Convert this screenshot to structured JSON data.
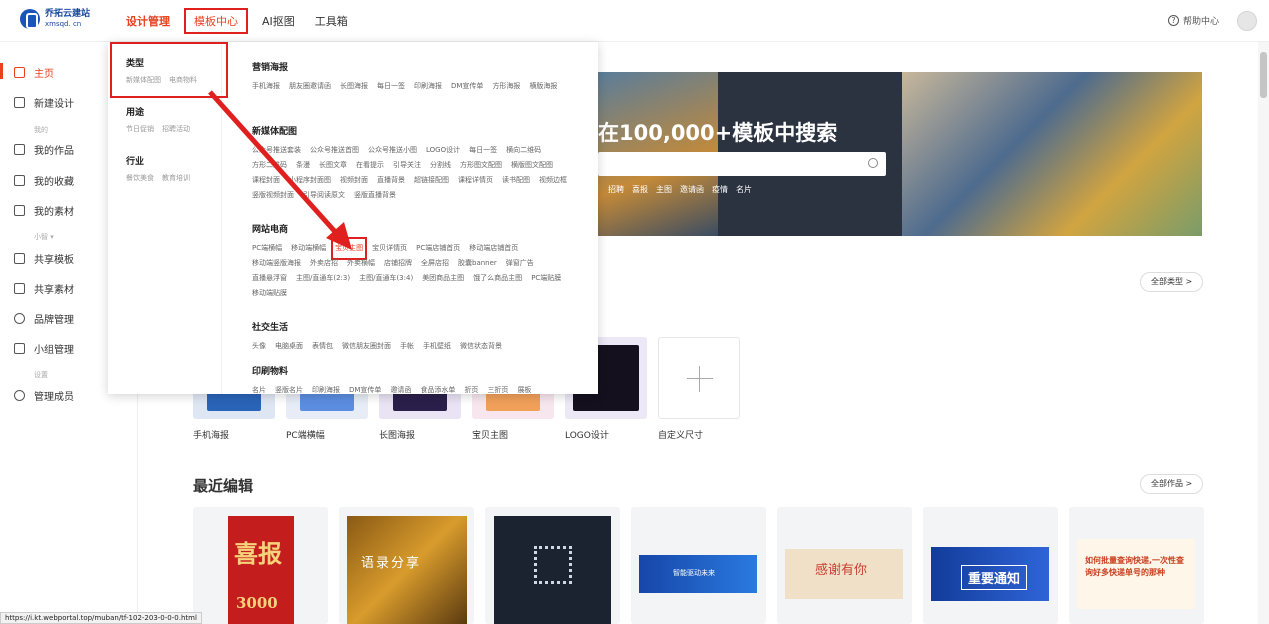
{
  "header": {
    "logo_cn": "乔拓云建站",
    "logo_en": "xmsqd. cn",
    "nav": [
      "设计管理",
      "模板中心",
      "AI抠图",
      "工具箱"
    ],
    "help": "帮助中心"
  },
  "sidebar": {
    "items": [
      {
        "label": "主页"
      },
      {
        "label": "新建设计"
      },
      {
        "label": "我的作品"
      },
      {
        "label": "我的收藏"
      },
      {
        "label": "我的素材"
      },
      {
        "label": "共享模板"
      },
      {
        "label": "共享素材"
      },
      {
        "label": "品牌管理"
      },
      {
        "label": "小组管理"
      },
      {
        "label": "管理成员"
      }
    ],
    "sections": [
      "我的",
      "小智 ▾",
      "设置"
    ]
  },
  "dropdown": {
    "left": [
      {
        "head": "类型",
        "subs": [
          "新媒体配图",
          "电商物料"
        ]
      },
      {
        "head": "用途",
        "subs": [
          "节日促销",
          "招聘活动"
        ]
      },
      {
        "head": "行业",
        "subs": [
          "餐饮美食",
          "教育培训"
        ]
      }
    ],
    "categories": [
      {
        "title": "营销海报",
        "items": [
          "手机海报",
          "朋友圈邀请函",
          "长图海报",
          "每日一签",
          "印刷海报",
          "DM宣传单",
          "方形海报",
          "横版海报"
        ]
      },
      {
        "title": "新媒体配图",
        "items": [
          "公众号推送套装",
          "公众号推送首图",
          "公众号推送小图",
          "LOGO设计",
          "每日一签",
          "横向二维码",
          "方形二维码",
          "条漫",
          "长图文章",
          "在看提示",
          "引导关注",
          "分割线",
          "方形图文配图",
          "横版图文配图",
          "课程封面",
          "小程序封面图",
          "视频封面",
          "直播背景",
          "超链接配图",
          "课程详情页",
          "读书配图",
          "视频边框",
          "竖版视频封面",
          "引导阅读原文",
          "竖版直播背景"
        ]
      },
      {
        "title": "网站电商",
        "items": [
          "PC端横幅",
          "移动端横幅",
          "宝贝主图",
          "宝贝详情页",
          "PC端店铺首页",
          "移动端店铺首页",
          "移动端竖版海报",
          "外卖店招",
          "外卖横幅",
          "店铺招牌",
          "全屏店招",
          "胶囊banner",
          "弹窗广告",
          "直播悬浮窗",
          "主图/直通车(2:3)",
          "主图/直通车(3:4)",
          "美团商品主图",
          "饿了么商品主图",
          "PC端贴膜",
          "移动端贴膜"
        ]
      },
      {
        "title": "社交生活",
        "items": [
          "头像",
          "电脑桌面",
          "表情包",
          "微信朋友圈封面",
          "手帐",
          "手机壁纸",
          "微信状态背景"
        ]
      },
      {
        "title": "印刷物料",
        "items": [
          "名片",
          "竖版名片",
          "印刷海报",
          "DM宣传单",
          "邀请函",
          "食品添水单",
          "折页",
          "三折页",
          "展板"
        ]
      }
    ]
  },
  "banner": {
    "title": "在100,000+模板中搜索",
    "search_placeholder": "",
    "hot_tags": [
      "招聘",
      "喜报",
      "主图",
      "邀请函",
      "疫情",
      "名片"
    ]
  },
  "quick": {
    "all_types": "全部类型 >",
    "labels": [
      "手机海报",
      "PC端横幅",
      "长图海报",
      "宝贝主图",
      "LOGO设计",
      "自定义尺寸"
    ]
  },
  "recent": {
    "title": "最近编辑",
    "all_works": "全部作品 >",
    "cards": [
      {
        "text": "喜报",
        "extra": "3000"
      },
      {
        "text": "语录分享"
      },
      {
        "text": ""
      },
      {
        "text": "智能驱动未来"
      },
      {
        "text": "感谢有你"
      },
      {
        "text": "重要通知"
      },
      {
        "text": "如何批量查询快递,一次性查询好多快递单号的那种"
      }
    ]
  },
  "status_url": "https://i.kt.webportal.top/muban/tf-102-203-0-0-0.html"
}
